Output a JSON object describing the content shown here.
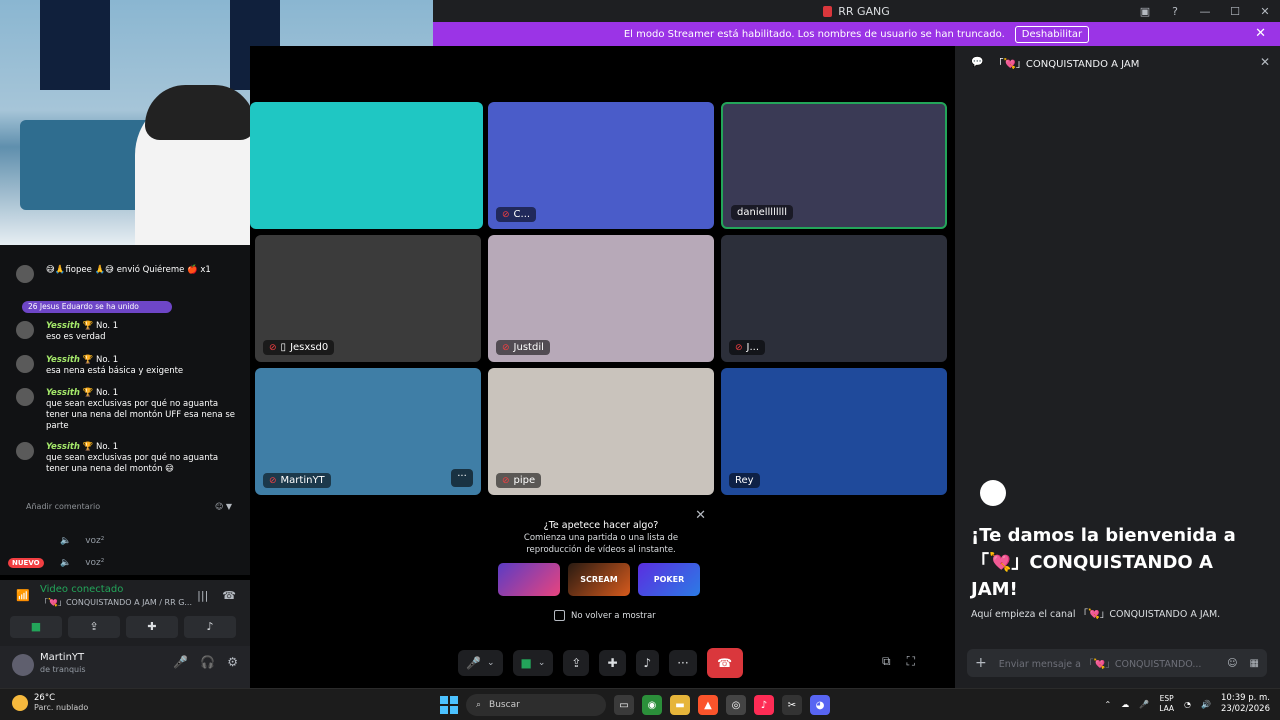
{
  "window": {
    "title": "RR GANG",
    "controls": [
      "▣",
      "?",
      "—",
      "☐",
      "✕"
    ]
  },
  "streamer_banner": {
    "text": "El modo Streamer está habilitado. Los nombres de usuario se han truncado.",
    "button": "Deshabilitar"
  },
  "overlay_chat": {
    "gift_line": "😅🙏fiopee 🙏😅 envió Quiéreme 🍎 x1",
    "highlight": "26 Jesus Eduardo se ha unido",
    "messages": [
      {
        "user": "Yessith",
        "text": "eso es verdad"
      },
      {
        "user": "Yessith",
        "text": "esa nena está básica y exigente"
      },
      {
        "user": "Yessith",
        "text": "que sean exclusivas por qué no aguanta tener una nena del montón UFF esa nena se parte"
      },
      {
        "user": "Yessith",
        "text": "que sean exclusivas por qué no aguanta tener una nena del montón 😄"
      }
    ],
    "badge": "No. 1",
    "input_placeholder": "Añadir comentario"
  },
  "sidebar": {
    "voice_users": [
      {
        "label": "voz²"
      },
      {
        "label": "voz²"
      }
    ],
    "new_badge": "NUEVO",
    "voice_connected": {
      "status": "Video conectado",
      "channel": "「💘」CONQUISTANDO A JAM / RR G..."
    },
    "user": {
      "name": "MartinYT",
      "status": "de tranquis"
    }
  },
  "call": {
    "tiles": [
      {
        "name": "",
        "bg": "#1fc7c3",
        "speaking": false
      },
      {
        "name": "C...",
        "bg": "#4a5cc9",
        "speaking": false
      },
      {
        "name": "daniellllllll",
        "bg": "#3a3a55",
        "speaking": true
      },
      {
        "name": "Jesxsd0",
        "bg": "#3b3b3b",
        "speaking": false
      },
      {
        "name": "Justdil",
        "bg": "#b7a9b8",
        "speaking": false
      },
      {
        "name": "J...",
        "bg": "#2c2f3a",
        "speaking": false
      },
      {
        "name": "MartinYT",
        "bg": "#3f7ea6",
        "speaking": false
      },
      {
        "name": "pipe",
        "bg": "#c9c3bc",
        "speaking": false
      },
      {
        "name": "Rey",
        "bg": "#1f4a9b",
        "speaking": false
      }
    ],
    "activity_popup": {
      "title": "¿Te apetece hacer algo?",
      "subtitle": "Comienza una partida o una lista de reproducción de vídeos al instante.",
      "games": [
        "",
        "SCREAM",
        "POKER"
      ],
      "checkbox": "No volver a mostrar"
    }
  },
  "text_chat": {
    "channel": "「💘」CONQUISTANDO A JAM",
    "welcome": "¡Te damos la bienvenida a 「💘」CONQUISTANDO A JAM!",
    "description": "Aquí empieza el canal 「💘」CONQUISTANDO A JAM.",
    "placeholder": "Enviar mensaje a 「💘」CONQUISTANDO..."
  },
  "taskbar": {
    "weather_temp": "26°C",
    "weather_desc": "Parc. nublado",
    "search": "Buscar",
    "lang_top": "ESP",
    "lang_bottom": "LAA",
    "time": "10:39 p. m.",
    "date": "23/02/2026"
  },
  "colors": {
    "accent_purple": "#9b34e6",
    "green": "#23a55a",
    "red": "#da373c"
  }
}
